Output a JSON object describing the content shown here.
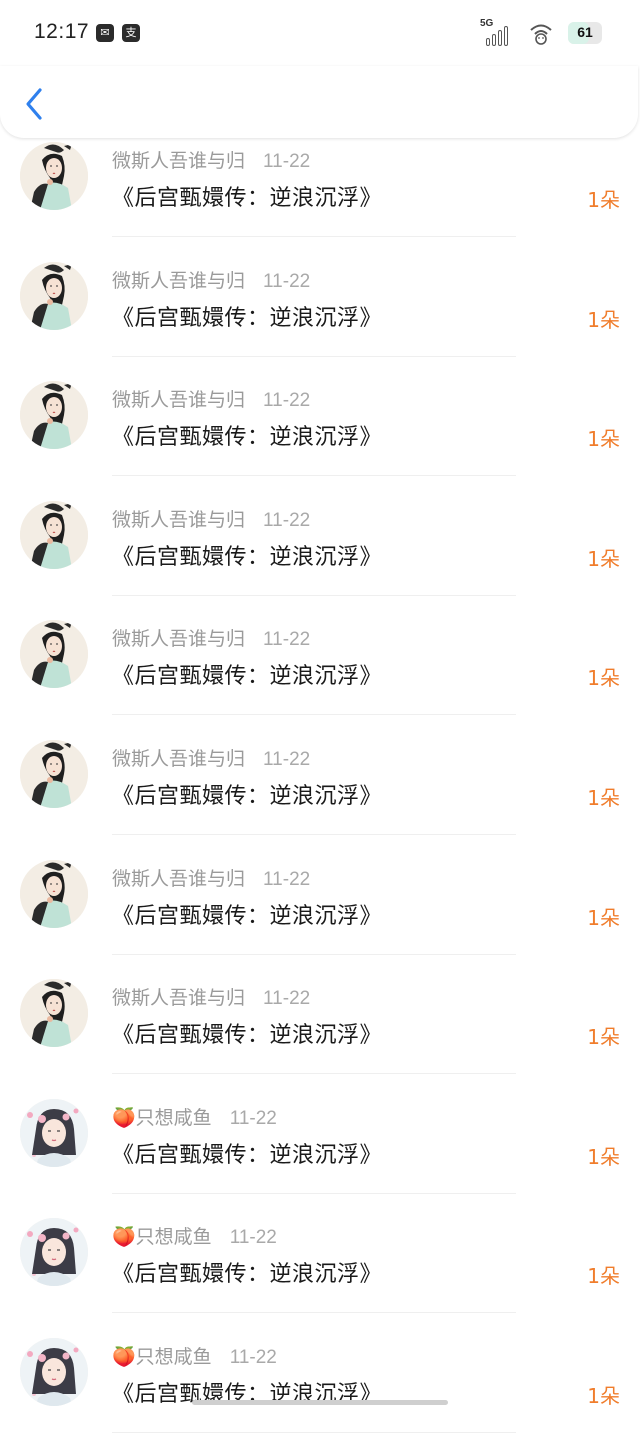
{
  "status_bar": {
    "time": "12:17",
    "network": "5G",
    "battery": "61",
    "battery_level": 0.61,
    "app_icons": [
      "mail-app-icon",
      "alipay-icon"
    ],
    "app_icon_glyphs": [
      "✉",
      "支"
    ]
  },
  "header": {
    "back_icon": "chevron-left-icon",
    "accent": "#2f80ed"
  },
  "colors": {
    "count": "#f07d2c",
    "name": "#9a9a9a",
    "title": "#1a1a1a"
  },
  "list": [
    {
      "emoji": "",
      "name": "微斯人吾谁与归",
      "date": "11-22",
      "title": "《后宫甄嬛传：逆浪沉浮》",
      "count": "1朵",
      "avatar": "avatar-girl-ink"
    },
    {
      "emoji": "",
      "name": "微斯人吾谁与归",
      "date": "11-22",
      "title": "《后宫甄嬛传：逆浪沉浮》",
      "count": "1朵",
      "avatar": "avatar-girl-ink"
    },
    {
      "emoji": "",
      "name": "微斯人吾谁与归",
      "date": "11-22",
      "title": "《后宫甄嬛传：逆浪沉浮》",
      "count": "1朵",
      "avatar": "avatar-girl-ink"
    },
    {
      "emoji": "",
      "name": "微斯人吾谁与归",
      "date": "11-22",
      "title": "《后宫甄嬛传：逆浪沉浮》",
      "count": "1朵",
      "avatar": "avatar-girl-ink"
    },
    {
      "emoji": "",
      "name": "微斯人吾谁与归",
      "date": "11-22",
      "title": "《后宫甄嬛传：逆浪沉浮》",
      "count": "1朵",
      "avatar": "avatar-girl-ink"
    },
    {
      "emoji": "",
      "name": "微斯人吾谁与归",
      "date": "11-22",
      "title": "《后宫甄嬛传：逆浪沉浮》",
      "count": "1朵",
      "avatar": "avatar-girl-ink"
    },
    {
      "emoji": "",
      "name": "微斯人吾谁与归",
      "date": "11-22",
      "title": "《后宫甄嬛传：逆浪沉浮》",
      "count": "1朵",
      "avatar": "avatar-girl-ink"
    },
    {
      "emoji": "",
      "name": "微斯人吾谁与归",
      "date": "11-22",
      "title": "《后宫甄嬛传：逆浪沉浮》",
      "count": "1朵",
      "avatar": "avatar-girl-ink"
    },
    {
      "emoji": "🍑",
      "name": "只想咸鱼",
      "date": "11-22",
      "title": "《后宫甄嬛传：逆浪沉浮》",
      "count": "1朵",
      "avatar": "avatar-girl-pink"
    },
    {
      "emoji": "🍑",
      "name": "只想咸鱼",
      "date": "11-22",
      "title": "《后宫甄嬛传：逆浪沉浮》",
      "count": "1朵",
      "avatar": "avatar-girl-pink"
    },
    {
      "emoji": "🍑",
      "name": "只想咸鱼",
      "date": "11-22",
      "title": "《后宫甄嬛传：逆浪沉浮》",
      "count": "1朵",
      "avatar": "avatar-girl-pink"
    }
  ]
}
